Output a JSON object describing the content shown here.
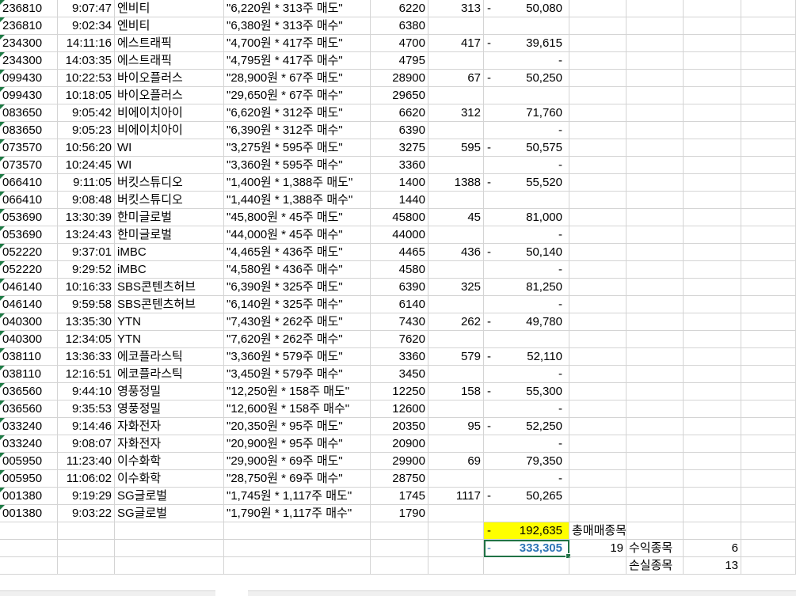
{
  "rows": [
    {
      "code": "236810",
      "time": "9:07:47",
      "name": "엔비티",
      "desc": "\"6,220원 * 313주 매도\"",
      "price": "6220",
      "qty": "313",
      "neg": "-",
      "amount": "50,080"
    },
    {
      "code": "236810",
      "time": "9:02:34",
      "name": "엔비티",
      "desc": "\"6,380원 * 313주 매수\"",
      "price": "6380",
      "qty": "",
      "neg": "",
      "amount": ""
    },
    {
      "code": "234300",
      "time": "14:11:16",
      "name": "에스트래픽",
      "desc": "\"4,700원 * 417주 매도\"",
      "price": "4700",
      "qty": "417",
      "neg": "-",
      "amount": "39,615"
    },
    {
      "code": "234300",
      "time": "14:03:35",
      "name": "에스트래픽",
      "desc": "\"4,795원 * 417주 매수\"",
      "price": "4795",
      "qty": "",
      "neg": "",
      "amount": "-"
    },
    {
      "code": "099430",
      "time": "10:22:53",
      "name": "바이오플러스",
      "desc": "\"28,900원 * 67주 매도\"",
      "price": "28900",
      "qty": "67",
      "neg": "-",
      "amount": "50,250"
    },
    {
      "code": "099430",
      "time": "10:18:05",
      "name": "바이오플러스",
      "desc": "\"29,650원 * 67주 매수\"",
      "price": "29650",
      "qty": "",
      "neg": "",
      "amount": ""
    },
    {
      "code": "083650",
      "time": "9:05:42",
      "name": "비에이치아이",
      "desc": "\"6,620원 * 312주 매도\"",
      "price": "6620",
      "qty": "312",
      "neg": "",
      "amount": "71,760"
    },
    {
      "code": "083650",
      "time": "9:05:23",
      "name": "비에이치아이",
      "desc": "\"6,390원 * 312주 매수\"",
      "price": "6390",
      "qty": "",
      "neg": "",
      "amount": "-"
    },
    {
      "code": "073570",
      "time": "10:56:20",
      "name": "WI",
      "desc": "\"3,275원 * 595주 매도\"",
      "price": "3275",
      "qty": "595",
      "neg": "-",
      "amount": "50,575"
    },
    {
      "code": "073570",
      "time": "10:24:45",
      "name": "WI",
      "desc": "\"3,360원 * 595주 매수\"",
      "price": "3360",
      "qty": "",
      "neg": "",
      "amount": "-"
    },
    {
      "code": "066410",
      "time": "9:11:05",
      "name": "버킷스튜디오",
      "desc": "\"1,400원 * 1,388주 매도\"",
      "price": "1400",
      "qty": "1388",
      "neg": "-",
      "amount": "55,520"
    },
    {
      "code": "066410",
      "time": "9:08:48",
      "name": "버킷스튜디오",
      "desc": "\"1,440원 * 1,388주 매수\"",
      "price": "1440",
      "qty": "",
      "neg": "",
      "amount": ""
    },
    {
      "code": "053690",
      "time": "13:30:39",
      "name": "한미글로벌",
      "desc": "\"45,800원 * 45주 매도\"",
      "price": "45800",
      "qty": "45",
      "neg": "",
      "amount": "81,000"
    },
    {
      "code": "053690",
      "time": "13:24:43",
      "name": "한미글로벌",
      "desc": "\"44,000원 * 45주 매수\"",
      "price": "44000",
      "qty": "",
      "neg": "",
      "amount": "-"
    },
    {
      "code": "052220",
      "time": "9:37:01",
      "name": "iMBC",
      "desc": "\"4,465원 * 436주 매도\"",
      "price": "4465",
      "qty": "436",
      "neg": "-",
      "amount": "50,140"
    },
    {
      "code": "052220",
      "time": "9:29:52",
      "name": "iMBC",
      "desc": "\"4,580원 * 436주 매수\"",
      "price": "4580",
      "qty": "",
      "neg": "",
      "amount": "-"
    },
    {
      "code": "046140",
      "time": "10:16:33",
      "name": "SBS콘텐츠허브",
      "desc": "\"6,390원 * 325주 매도\"",
      "price": "6390",
      "qty": "325",
      "neg": "",
      "amount": "81,250"
    },
    {
      "code": "046140",
      "time": "9:59:58",
      "name": "SBS콘텐츠허브",
      "desc": "\"6,140원 * 325주 매수\"",
      "price": "6140",
      "qty": "",
      "neg": "",
      "amount": "-"
    },
    {
      "code": "040300",
      "time": "13:35:30",
      "name": "YTN",
      "desc": "\"7,430원 * 262주 매도\"",
      "price": "7430",
      "qty": "262",
      "neg": "-",
      "amount": "49,780"
    },
    {
      "code": "040300",
      "time": "12:34:05",
      "name": "YTN",
      "desc": "\"7,620원 * 262주 매수\"",
      "price": "7620",
      "qty": "",
      "neg": "",
      "amount": ""
    },
    {
      "code": "038110",
      "time": "13:36:33",
      "name": "에코플라스틱",
      "desc": "\"3,360원 * 579주 매도\"",
      "price": "3360",
      "qty": "579",
      "neg": "-",
      "amount": "52,110"
    },
    {
      "code": "038110",
      "time": "12:16:51",
      "name": "에코플라스틱",
      "desc": "\"3,450원 * 579주 매수\"",
      "price": "3450",
      "qty": "",
      "neg": "",
      "amount": "-"
    },
    {
      "code": "036560",
      "time": "9:44:10",
      "name": "영풍정밀",
      "desc": "\"12,250원 * 158주 매도\"",
      "price": "12250",
      "qty": "158",
      "neg": "-",
      "amount": "55,300"
    },
    {
      "code": "036560",
      "time": "9:35:53",
      "name": "영풍정밀",
      "desc": "\"12,600원 * 158주 매수\"",
      "price": "12600",
      "qty": "",
      "neg": "",
      "amount": "-"
    },
    {
      "code": "033240",
      "time": "9:14:46",
      "name": "자화전자",
      "desc": "\"20,350원 * 95주 매도\"",
      "price": "20350",
      "qty": "95",
      "neg": "-",
      "amount": "52,250"
    },
    {
      "code": "033240",
      "time": "9:08:07",
      "name": "자화전자",
      "desc": "\"20,900원 * 95주 매수\"",
      "price": "20900",
      "qty": "",
      "neg": "",
      "amount": "-"
    },
    {
      "code": "005950",
      "time": "11:23:40",
      "name": "이수화학",
      "desc": "\"29,900원 * 69주 매도\"",
      "price": "29900",
      "qty": "69",
      "neg": "",
      "amount": "79,350"
    },
    {
      "code": "005950",
      "time": "11:06:02",
      "name": "이수화학",
      "desc": "\"28,750원 * 69주 매수\"",
      "price": "28750",
      "qty": "",
      "neg": "",
      "amount": "-"
    },
    {
      "code": "001380",
      "time": "9:19:29",
      "name": "SG글로벌",
      "desc": "\"1,745원 * 1,117주 매도\"",
      "price": "1745",
      "qty": "1117",
      "neg": "-",
      "amount": "50,265"
    },
    {
      "code": "001380",
      "time": "9:03:22",
      "name": "SG글로벌",
      "desc": "\"1,790원 * 1,117주 매수\"",
      "price": "1790",
      "qty": "",
      "neg": "",
      "amount": ""
    }
  ],
  "summary": {
    "total_neg": "-",
    "total_amount": "192,635",
    "total_label": "총매매종목",
    "selected_neg": "-",
    "selected_amount": "333,305",
    "trade_count": "19",
    "profit_label": "수익종목",
    "profit_count": "6",
    "loss_label": "손실종목",
    "loss_count": "13"
  },
  "colors": {
    "highlight": "#ffff00",
    "selection": "#217346",
    "blue_text": "#2e75b6",
    "flag": "#1e7b45"
  }
}
